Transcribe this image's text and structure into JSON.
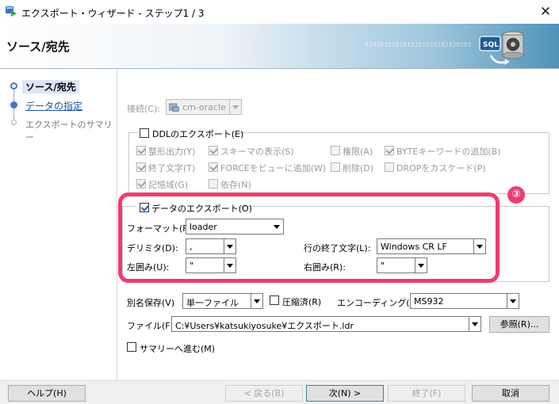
{
  "window": {
    "title": "エクスポート・ウィザード - ステップ1 / 3"
  },
  "header": {
    "title": "ソース/宛先",
    "binary_text": "0101010101010101010101010101"
  },
  "steps": [
    {
      "label": "ソース/宛先",
      "state": "current"
    },
    {
      "label": "データの指定",
      "state": "link"
    },
    {
      "label": "エクスポートのサマリー",
      "state": "pending"
    }
  ],
  "connection": {
    "label": "接続(C):",
    "value": "cm-oracle"
  },
  "ddl": {
    "label": "DDLのエクスポート(E)",
    "checked": false,
    "options": [
      {
        "label": "整形出力(Y)",
        "checked": true
      },
      {
        "label": "スキーマの表示(S)",
        "checked": true
      },
      {
        "label": "権限(A)",
        "checked": false
      },
      {
        "label": "BYTEキーワードの追加(B)",
        "checked": true
      },
      {
        "label": "終了文字(T)",
        "checked": true
      },
      {
        "label": "FORCEをビューに追加(W)",
        "checked": true
      },
      {
        "label": "削除(D)",
        "checked": false
      },
      {
        "label": "DROPをカスケード(P)",
        "checked": false
      },
      {
        "label": "記憶域(G)",
        "checked": true
      },
      {
        "label": "依存(N)",
        "checked": false
      }
    ]
  },
  "data_export": {
    "label": "データのエクスポート(O)",
    "checked": true,
    "format_label": "フォーマット(F):",
    "format_value": "loader",
    "delimiter_label": "デリミタ(D):",
    "delimiter_value": ",",
    "line_end_label": "行の終了文字(L):",
    "line_end_value": "Windows CR LF",
    "left_enclosure_label": "左囲み(U):",
    "left_enclosure_value": "\"",
    "right_enclosure_label": "右囲み(R):",
    "right_enclosure_value": "\""
  },
  "save_as": {
    "label": "別名保存(V)",
    "value": "単一ファイル",
    "compress_label": "圧縮済(R)",
    "compress_checked": false,
    "encoding_label": "エンコーディング(I):",
    "encoding_value": "MS932"
  },
  "file": {
    "label": "ファイル(F):",
    "value": "C:¥Users¥katsukiyosuke¥エクスポート.ldr",
    "browse_label": "参照(R)..."
  },
  "summary": {
    "label": "サマリーへ進む(M)",
    "checked": false
  },
  "annotation": {
    "badge": "③",
    "color": "#ee3d6f"
  },
  "footer": {
    "help": "ヘルプ(H)",
    "back": "< 戻る(B)",
    "next": "次(N) >",
    "finish": "終了(F)",
    "cancel": "取消"
  }
}
